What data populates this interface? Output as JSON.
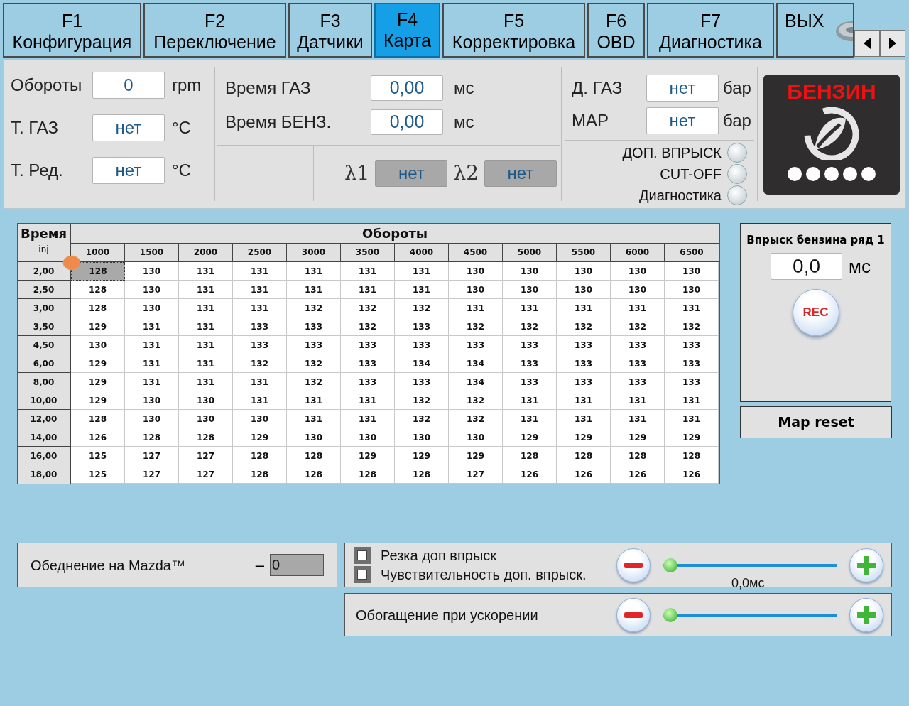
{
  "tabs": [
    {
      "key": "F1",
      "label": "Конфигурация",
      "selected": false
    },
    {
      "key": "F2",
      "label": "Переключение",
      "selected": false
    },
    {
      "key": "F3",
      "label": "Датчики",
      "selected": false
    },
    {
      "key": "F4",
      "label": "Карта",
      "selected": true
    },
    {
      "key": "F5",
      "label": "Корректировка",
      "selected": false
    },
    {
      "key": "F6",
      "label": "OBD",
      "selected": false
    },
    {
      "key": "F7",
      "label": "Диагностика",
      "selected": false
    },
    {
      "key": "ВЫХ",
      "kind": "exit",
      "selected": false
    }
  ],
  "engine": [
    {
      "label": "Обороты",
      "value": "0",
      "unit": "rpm"
    },
    {
      "label": "Т. ГАЗ",
      "value": "нет",
      "unit": "°C"
    },
    {
      "label": "Т. Ред.",
      "value": "нет",
      "unit": "°C"
    }
  ],
  "timing": [
    {
      "label": "Время ГАЗ",
      "value": "0,00",
      "unit": "мс"
    },
    {
      "label": "Время БЕНЗ.",
      "value": "0,00",
      "unit": "мс"
    }
  ],
  "lambda": [
    {
      "label": "λ1",
      "value": "нет",
      "disabled": true
    },
    {
      "label": "λ2",
      "value": "нет",
      "disabled": true
    }
  ],
  "pressure": [
    {
      "label": "Д. ГАЗ",
      "value": "нет",
      "unit": "бар"
    },
    {
      "label": "MAP",
      "value": "нет",
      "unit": "бар"
    }
  ],
  "indicators": [
    {
      "label": "ДОП. ВПРЫСК",
      "on": false
    },
    {
      "label": "CUT-OFF",
      "on": false
    },
    {
      "label": "Диагностика",
      "on": false
    }
  ],
  "fuel_badge": {
    "label": "БЕНЗИН"
  },
  "map_table": {
    "corner_title": "Время",
    "corner_sub": "inj",
    "columns_title": "Обороты",
    "columns": [
      "1000",
      "1500",
      "2000",
      "2500",
      "3000",
      "3500",
      "4000",
      "4500",
      "5000",
      "5500",
      "6000",
      "6500"
    ],
    "rows": [
      {
        "label": "2,00",
        "cells": [
          {
            "v": "128",
            "selected": true
          },
          {
            "v": "130",
            "selected": false
          },
          {
            "v": "131",
            "selected": false
          },
          {
            "v": "131",
            "selected": false
          },
          {
            "v": "131",
            "selected": false
          },
          {
            "v": "131",
            "selected": false
          },
          {
            "v": "131",
            "selected": false
          },
          {
            "v": "130",
            "selected": false
          },
          {
            "v": "130",
            "selected": false
          },
          {
            "v": "130",
            "selected": false
          },
          {
            "v": "130",
            "selected": false
          },
          {
            "v": "130",
            "selected": false
          }
        ]
      },
      {
        "label": "2,50",
        "cells": [
          {
            "v": "128",
            "selected": false
          },
          {
            "v": "130",
            "selected": false
          },
          {
            "v": "131",
            "selected": false
          },
          {
            "v": "131",
            "selected": false
          },
          {
            "v": "131",
            "selected": false
          },
          {
            "v": "131",
            "selected": false
          },
          {
            "v": "131",
            "selected": false
          },
          {
            "v": "130",
            "selected": false
          },
          {
            "v": "130",
            "selected": false
          },
          {
            "v": "130",
            "selected": false
          },
          {
            "v": "130",
            "selected": false
          },
          {
            "v": "130",
            "selected": false
          }
        ]
      },
      {
        "label": "3,00",
        "cells": [
          {
            "v": "128",
            "selected": false
          },
          {
            "v": "130",
            "selected": false
          },
          {
            "v": "131",
            "selected": false
          },
          {
            "v": "131",
            "selected": false
          },
          {
            "v": "132",
            "selected": false
          },
          {
            "v": "132",
            "selected": false
          },
          {
            "v": "132",
            "selected": false
          },
          {
            "v": "131",
            "selected": false
          },
          {
            "v": "131",
            "selected": false
          },
          {
            "v": "131",
            "selected": false
          },
          {
            "v": "131",
            "selected": false
          },
          {
            "v": "131",
            "selected": false
          }
        ]
      },
      {
        "label": "3,50",
        "cells": [
          {
            "v": "129",
            "selected": false
          },
          {
            "v": "131",
            "selected": false
          },
          {
            "v": "131",
            "selected": false
          },
          {
            "v": "133",
            "selected": false
          },
          {
            "v": "133",
            "selected": false
          },
          {
            "v": "132",
            "selected": false
          },
          {
            "v": "133",
            "selected": false
          },
          {
            "v": "132",
            "selected": false
          },
          {
            "v": "132",
            "selected": false
          },
          {
            "v": "132",
            "selected": false
          },
          {
            "v": "132",
            "selected": false
          },
          {
            "v": "132",
            "selected": false
          }
        ]
      },
      {
        "label": "4,50",
        "cells": [
          {
            "v": "130",
            "selected": false
          },
          {
            "v": "131",
            "selected": false
          },
          {
            "v": "131",
            "selected": false
          },
          {
            "v": "133",
            "selected": false
          },
          {
            "v": "133",
            "selected": false
          },
          {
            "v": "133",
            "selected": false
          },
          {
            "v": "133",
            "selected": false
          },
          {
            "v": "133",
            "selected": false
          },
          {
            "v": "133",
            "selected": false
          },
          {
            "v": "133",
            "selected": false
          },
          {
            "v": "133",
            "selected": false
          },
          {
            "v": "133",
            "selected": false
          }
        ]
      },
      {
        "label": "6,00",
        "cells": [
          {
            "v": "129",
            "selected": false
          },
          {
            "v": "131",
            "selected": false
          },
          {
            "v": "131",
            "selected": false
          },
          {
            "v": "132",
            "selected": false
          },
          {
            "v": "132",
            "selected": false
          },
          {
            "v": "133",
            "selected": false
          },
          {
            "v": "134",
            "selected": false
          },
          {
            "v": "134",
            "selected": false
          },
          {
            "v": "133",
            "selected": false
          },
          {
            "v": "133",
            "selected": false
          },
          {
            "v": "133",
            "selected": false
          },
          {
            "v": "133",
            "selected": false
          }
        ]
      },
      {
        "label": "8,00",
        "cells": [
          {
            "v": "129",
            "selected": false
          },
          {
            "v": "131",
            "selected": false
          },
          {
            "v": "131",
            "selected": false
          },
          {
            "v": "131",
            "selected": false
          },
          {
            "v": "132",
            "selected": false
          },
          {
            "v": "133",
            "selected": false
          },
          {
            "v": "133",
            "selected": false
          },
          {
            "v": "134",
            "selected": false
          },
          {
            "v": "133",
            "selected": false
          },
          {
            "v": "133",
            "selected": false
          },
          {
            "v": "133",
            "selected": false
          },
          {
            "v": "133",
            "selected": false
          }
        ]
      },
      {
        "label": "10,00",
        "cells": [
          {
            "v": "129",
            "selected": false
          },
          {
            "v": "130",
            "selected": false
          },
          {
            "v": "130",
            "selected": false
          },
          {
            "v": "131",
            "selected": false
          },
          {
            "v": "131",
            "selected": false
          },
          {
            "v": "131",
            "selected": false
          },
          {
            "v": "132",
            "selected": false
          },
          {
            "v": "132",
            "selected": false
          },
          {
            "v": "131",
            "selected": false
          },
          {
            "v": "131",
            "selected": false
          },
          {
            "v": "131",
            "selected": false
          },
          {
            "v": "131",
            "selected": false
          }
        ]
      },
      {
        "label": "12,00",
        "cells": [
          {
            "v": "128",
            "selected": false
          },
          {
            "v": "130",
            "selected": false
          },
          {
            "v": "130",
            "selected": false
          },
          {
            "v": "130",
            "selected": false
          },
          {
            "v": "131",
            "selected": false
          },
          {
            "v": "131",
            "selected": false
          },
          {
            "v": "132",
            "selected": false
          },
          {
            "v": "132",
            "selected": false
          },
          {
            "v": "131",
            "selected": false
          },
          {
            "v": "131",
            "selected": false
          },
          {
            "v": "131",
            "selected": false
          },
          {
            "v": "131",
            "selected": false
          }
        ]
      },
      {
        "label": "14,00",
        "cells": [
          {
            "v": "126",
            "selected": false
          },
          {
            "v": "128",
            "selected": false
          },
          {
            "v": "128",
            "selected": false
          },
          {
            "v": "129",
            "selected": false
          },
          {
            "v": "130",
            "selected": false
          },
          {
            "v": "130",
            "selected": false
          },
          {
            "v": "130",
            "selected": false
          },
          {
            "v": "130",
            "selected": false
          },
          {
            "v": "129",
            "selected": false
          },
          {
            "v": "129",
            "selected": false
          },
          {
            "v": "129",
            "selected": false
          },
          {
            "v": "129",
            "selected": false
          }
        ]
      },
      {
        "label": "16,00",
        "cells": [
          {
            "v": "125",
            "selected": false
          },
          {
            "v": "127",
            "selected": false
          },
          {
            "v": "127",
            "selected": false
          },
          {
            "v": "128",
            "selected": false
          },
          {
            "v": "128",
            "selected": false
          },
          {
            "v": "129",
            "selected": false
          },
          {
            "v": "129",
            "selected": false
          },
          {
            "v": "129",
            "selected": false
          },
          {
            "v": "128",
            "selected": false
          },
          {
            "v": "128",
            "selected": false
          },
          {
            "v": "128",
            "selected": false
          },
          {
            "v": "128",
            "selected": false
          }
        ]
      },
      {
        "label": "18,00",
        "cells": [
          {
            "v": "125",
            "selected": false
          },
          {
            "v": "127",
            "selected": false
          },
          {
            "v": "127",
            "selected": false
          },
          {
            "v": "128",
            "selected": false
          },
          {
            "v": "128",
            "selected": false
          },
          {
            "v": "128",
            "selected": false
          },
          {
            "v": "128",
            "selected": false
          },
          {
            "v": "127",
            "selected": false
          },
          {
            "v": "126",
            "selected": false
          },
          {
            "v": "126",
            "selected": false
          },
          {
            "v": "126",
            "selected": false
          },
          {
            "v": "126",
            "selected": false
          }
        ]
      }
    ]
  },
  "injection_panel": {
    "title": "Впрыск бензина ряд 1",
    "value": "0,0",
    "unit": "мс",
    "rec_button": "REC"
  },
  "map_reset_button": "Map reset",
  "mazda": {
    "label": "Обеднение на Mazda™",
    "sign": "–",
    "value": "0",
    "disabled": true
  },
  "options": [
    {
      "label": "Резка доп впрыск",
      "checked": false
    },
    {
      "label": "Чувствительность доп. впрыск.",
      "checked": false
    }
  ],
  "options_slider": {
    "level": 0,
    "reading": "0,0мс"
  },
  "enrichment": {
    "label": "Обогащение при ускорении",
    "level": 0
  }
}
